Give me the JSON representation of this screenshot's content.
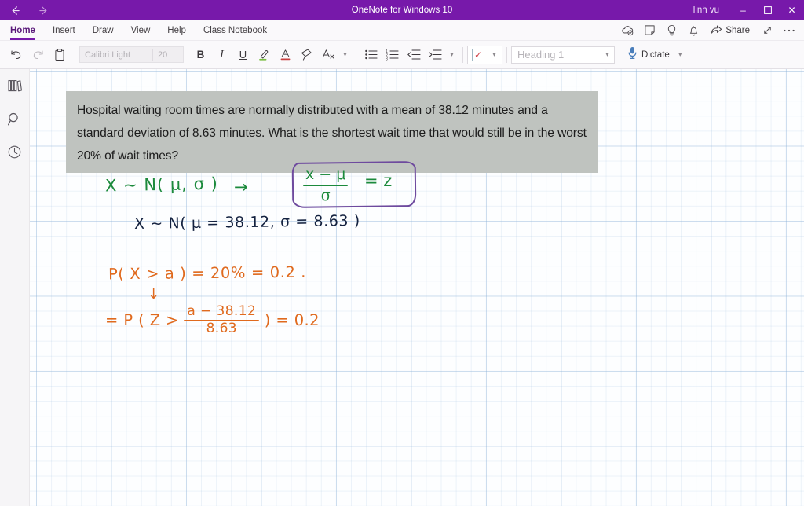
{
  "titlebar": {
    "back_icon": "back-arrow-icon",
    "forward_icon": "forward-arrow-icon",
    "app_title": "OneNote for Windows 10",
    "user": "linh vu",
    "minimize": "–",
    "restore": "❐",
    "close": "✕"
  },
  "tabs": [
    {
      "label": "Home",
      "active": true
    },
    {
      "label": "Insert",
      "active": false
    },
    {
      "label": "Draw",
      "active": false
    },
    {
      "label": "View",
      "active": false
    },
    {
      "label": "Help",
      "active": false
    },
    {
      "label": "Class Notebook",
      "active": false
    }
  ],
  "tabrow_right": {
    "sync_icon": "sync-cloud-icon",
    "sticky_notes_icon": "sticky-note-icon",
    "tell_me_icon": "lightbulb-icon",
    "notifications_icon": "bell-icon",
    "share_label": "Share",
    "share_icon": "share-icon",
    "expand_icon": "expand-diagonal-icon",
    "more_icon": "more-ellipsis-icon"
  },
  "ribbon": {
    "undo_icon": "undo-icon",
    "redo_icon": "redo-icon",
    "paste_icon": "clipboard-paste-icon",
    "font_name": "Calibri Light",
    "font_size": "20",
    "bold": "B",
    "italic": "I",
    "underline": "U",
    "highlight_icon": "highlighter-icon",
    "font_color_icon": "font-color-icon",
    "format_painter_icon": "format-painter-icon",
    "clear_formatting_icon": "clear-formatting-icon",
    "font_more_icon": "chevron-down-icon",
    "bullets_icon": "bulleted-list-icon",
    "numbering_icon": "numbered-list-icon",
    "decrease_indent_icon": "decrease-indent-icon",
    "increase_indent_icon": "increase-indent-icon",
    "paragraph_more_icon": "chevron-down-icon",
    "todo_tag_icon": "checkbox-tag-icon",
    "tag_more_icon": "chevron-down-icon",
    "style_value": "Heading 1",
    "style_caret_icon": "chevron-down-icon",
    "dictate_label": "Dictate",
    "dictate_icon": "microphone-icon",
    "dictate_caret_icon": "chevron-down-icon"
  },
  "leftrail": {
    "notebooks_icon": "notebooks-icon",
    "search_icon": "search-icon",
    "recent_icon": "recent-clock-icon"
  },
  "page": {
    "question": "Hospital waiting room times are normally distributed with a mean of 38.12 minutes and a standard deviation of 8.63 minutes. What is the shortest wait time that would still be in the worst 20% of wait times?",
    "notes": {
      "line1": "X ~ N( μ, σ )",
      "arrow1": "→",
      "formula_numerator": "x − μ",
      "formula_denominator": "σ",
      "formula_result": "= z",
      "line2": "X ~ N( μ = 38.12,  σ = 8.63 )",
      "line3": "P( X > a ) = 20%  = 0.2 .",
      "down_arrow": "↓",
      "line4_prefix": "= P ( Z  >",
      "line4_numerator": "a − 38.12",
      "line4_denominator": "8.63",
      "line4_suffix": ")  =  0.2"
    }
  },
  "colors": {
    "brand_purple": "#7719aa",
    "ink_green": "#1c8a3c",
    "ink_black": "#13213f",
    "ink_orange": "#e06a1e",
    "ink_box_purple": "#6e4a9e",
    "image_bg": "#bfc3bf"
  }
}
